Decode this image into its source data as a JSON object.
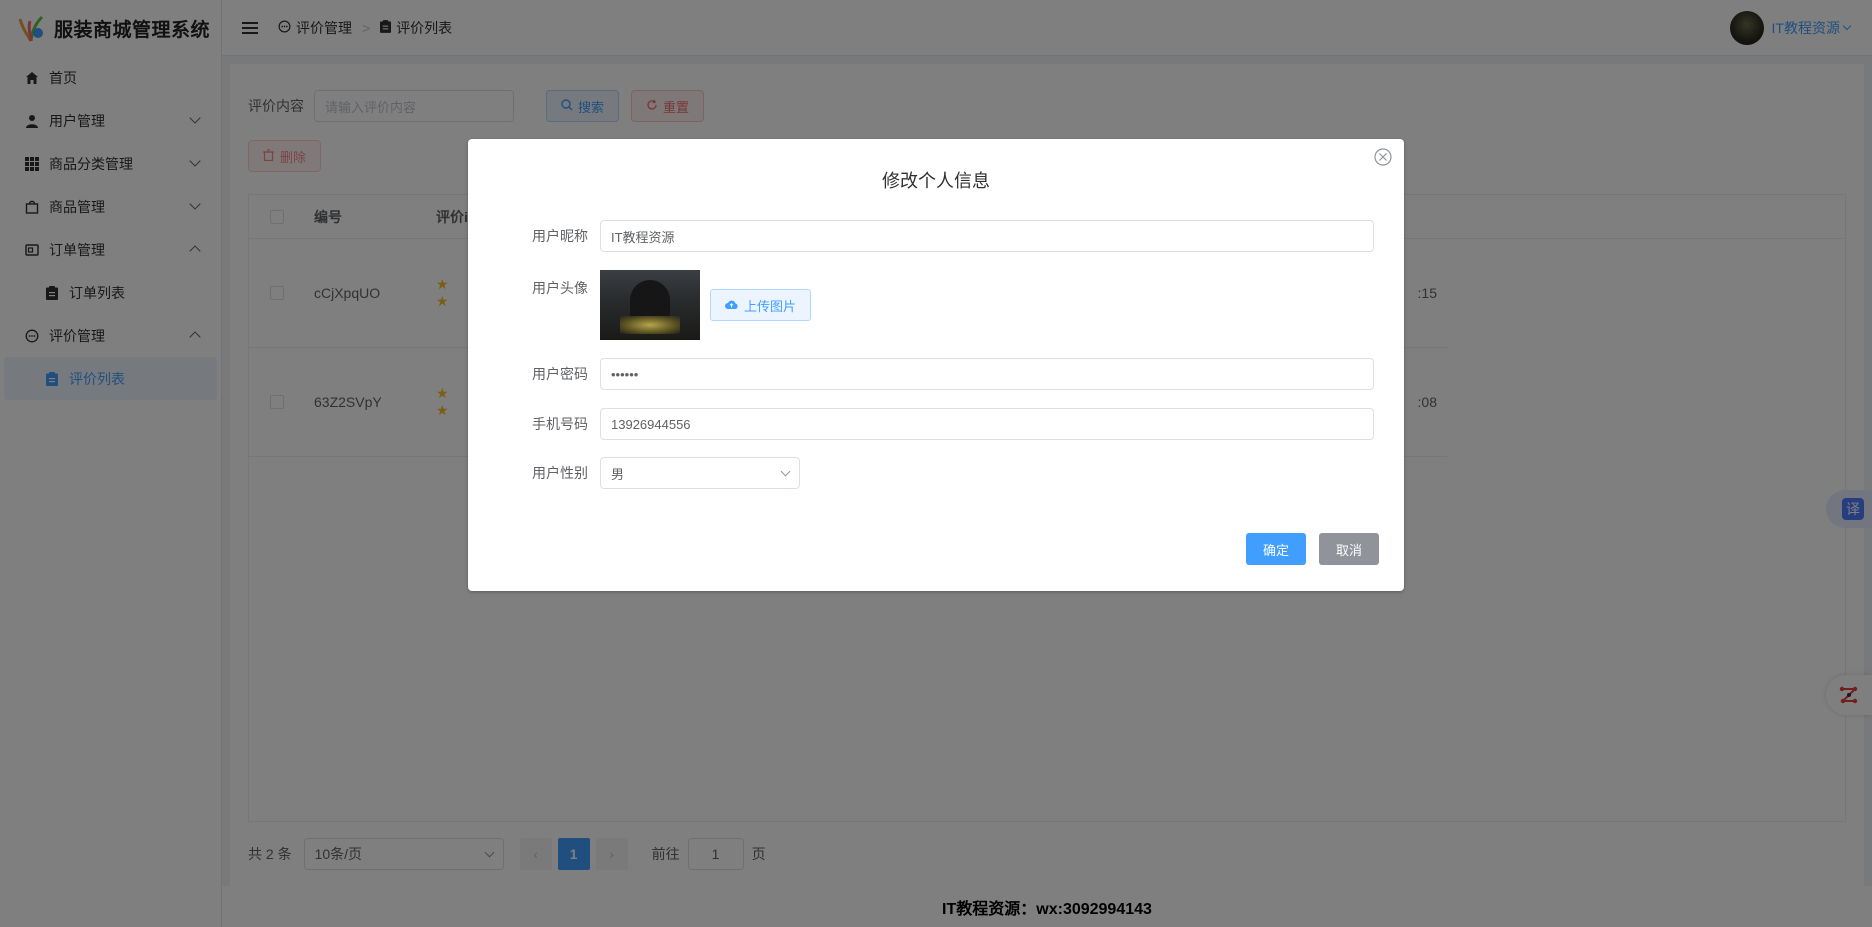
{
  "app": {
    "title": "服装商城管理系统"
  },
  "sidebar": {
    "items": [
      {
        "label": "首页"
      },
      {
        "label": "用户管理"
      },
      {
        "label": "商品分类管理"
      },
      {
        "label": "商品管理"
      },
      {
        "label": "订单管理"
      },
      {
        "label": "订单列表"
      },
      {
        "label": "评价管理"
      },
      {
        "label": "评价列表"
      }
    ]
  },
  "header": {
    "breadcrumb": [
      {
        "label": "评价管理"
      },
      {
        "label": "评价列表"
      }
    ],
    "user_name": "IT教程资源"
  },
  "search": {
    "label": "评价内容",
    "placeholder": "请输入评价内容",
    "search_button": "搜索",
    "reset_button": "重置",
    "delete_button": "删除"
  },
  "table": {
    "headers": [
      "编号",
      "评价i"
    ],
    "rows": [
      {
        "id": "cCjXpqUO",
        "time_tail": ":15"
      },
      {
        "id": "63Z2SVpY",
        "time_tail": ":08"
      }
    ]
  },
  "pagination": {
    "total": "共 2 条",
    "page_size": "10条/页",
    "current": "1",
    "goto_label": "前往",
    "goto_value": "1",
    "page_suffix": "页"
  },
  "footer": {
    "text": "IT教程资源：wx:3092994143"
  },
  "floating": {
    "translate_label": "译"
  },
  "dialog": {
    "title": "修改个人信息",
    "nickname_label": "用户昵称",
    "nickname_value": "IT教程资源",
    "avatar_label": "用户头像",
    "upload_button": "上传图片",
    "password_label": "用户密码",
    "password_value": "••••••",
    "phone_label": "手机号码",
    "phone_value": "13926944556",
    "gender_label": "用户性别",
    "gender_value": "男",
    "confirm_button": "确定",
    "cancel_button": "取消"
  },
  "colors": {
    "primary": "#409eff",
    "danger": "#f56c6c",
    "star": "#f7ba2a"
  }
}
